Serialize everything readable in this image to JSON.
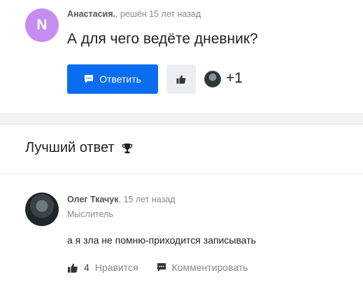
{
  "question": {
    "avatar_letter": "N",
    "author": "Анастасия.",
    "meta_suffix": ", решён 15 лет назад",
    "title": "А для чего ведёте дневник?",
    "answer_button_label": "Ответить",
    "like_count": "+1"
  },
  "best_answer": {
    "heading": "Лучший ответ",
    "author": "Олег Ткачук",
    "meta_suffix": ", 15 лет назад",
    "rank": "Мыслитель",
    "text": "а я зла не помню-приходится записывать",
    "likes": "4",
    "like_label": "Нравится",
    "comment_label": "Комментировать"
  },
  "colors": {
    "accent": "#0a6cf0",
    "avatar_purple": "#c58df0",
    "muted_text": "#8a8a8a"
  },
  "icons": {
    "answer_button": "chat-bubble-icon",
    "like": "thumbs-up-icon",
    "best": "trophy-icon",
    "comment": "comment-icon"
  }
}
